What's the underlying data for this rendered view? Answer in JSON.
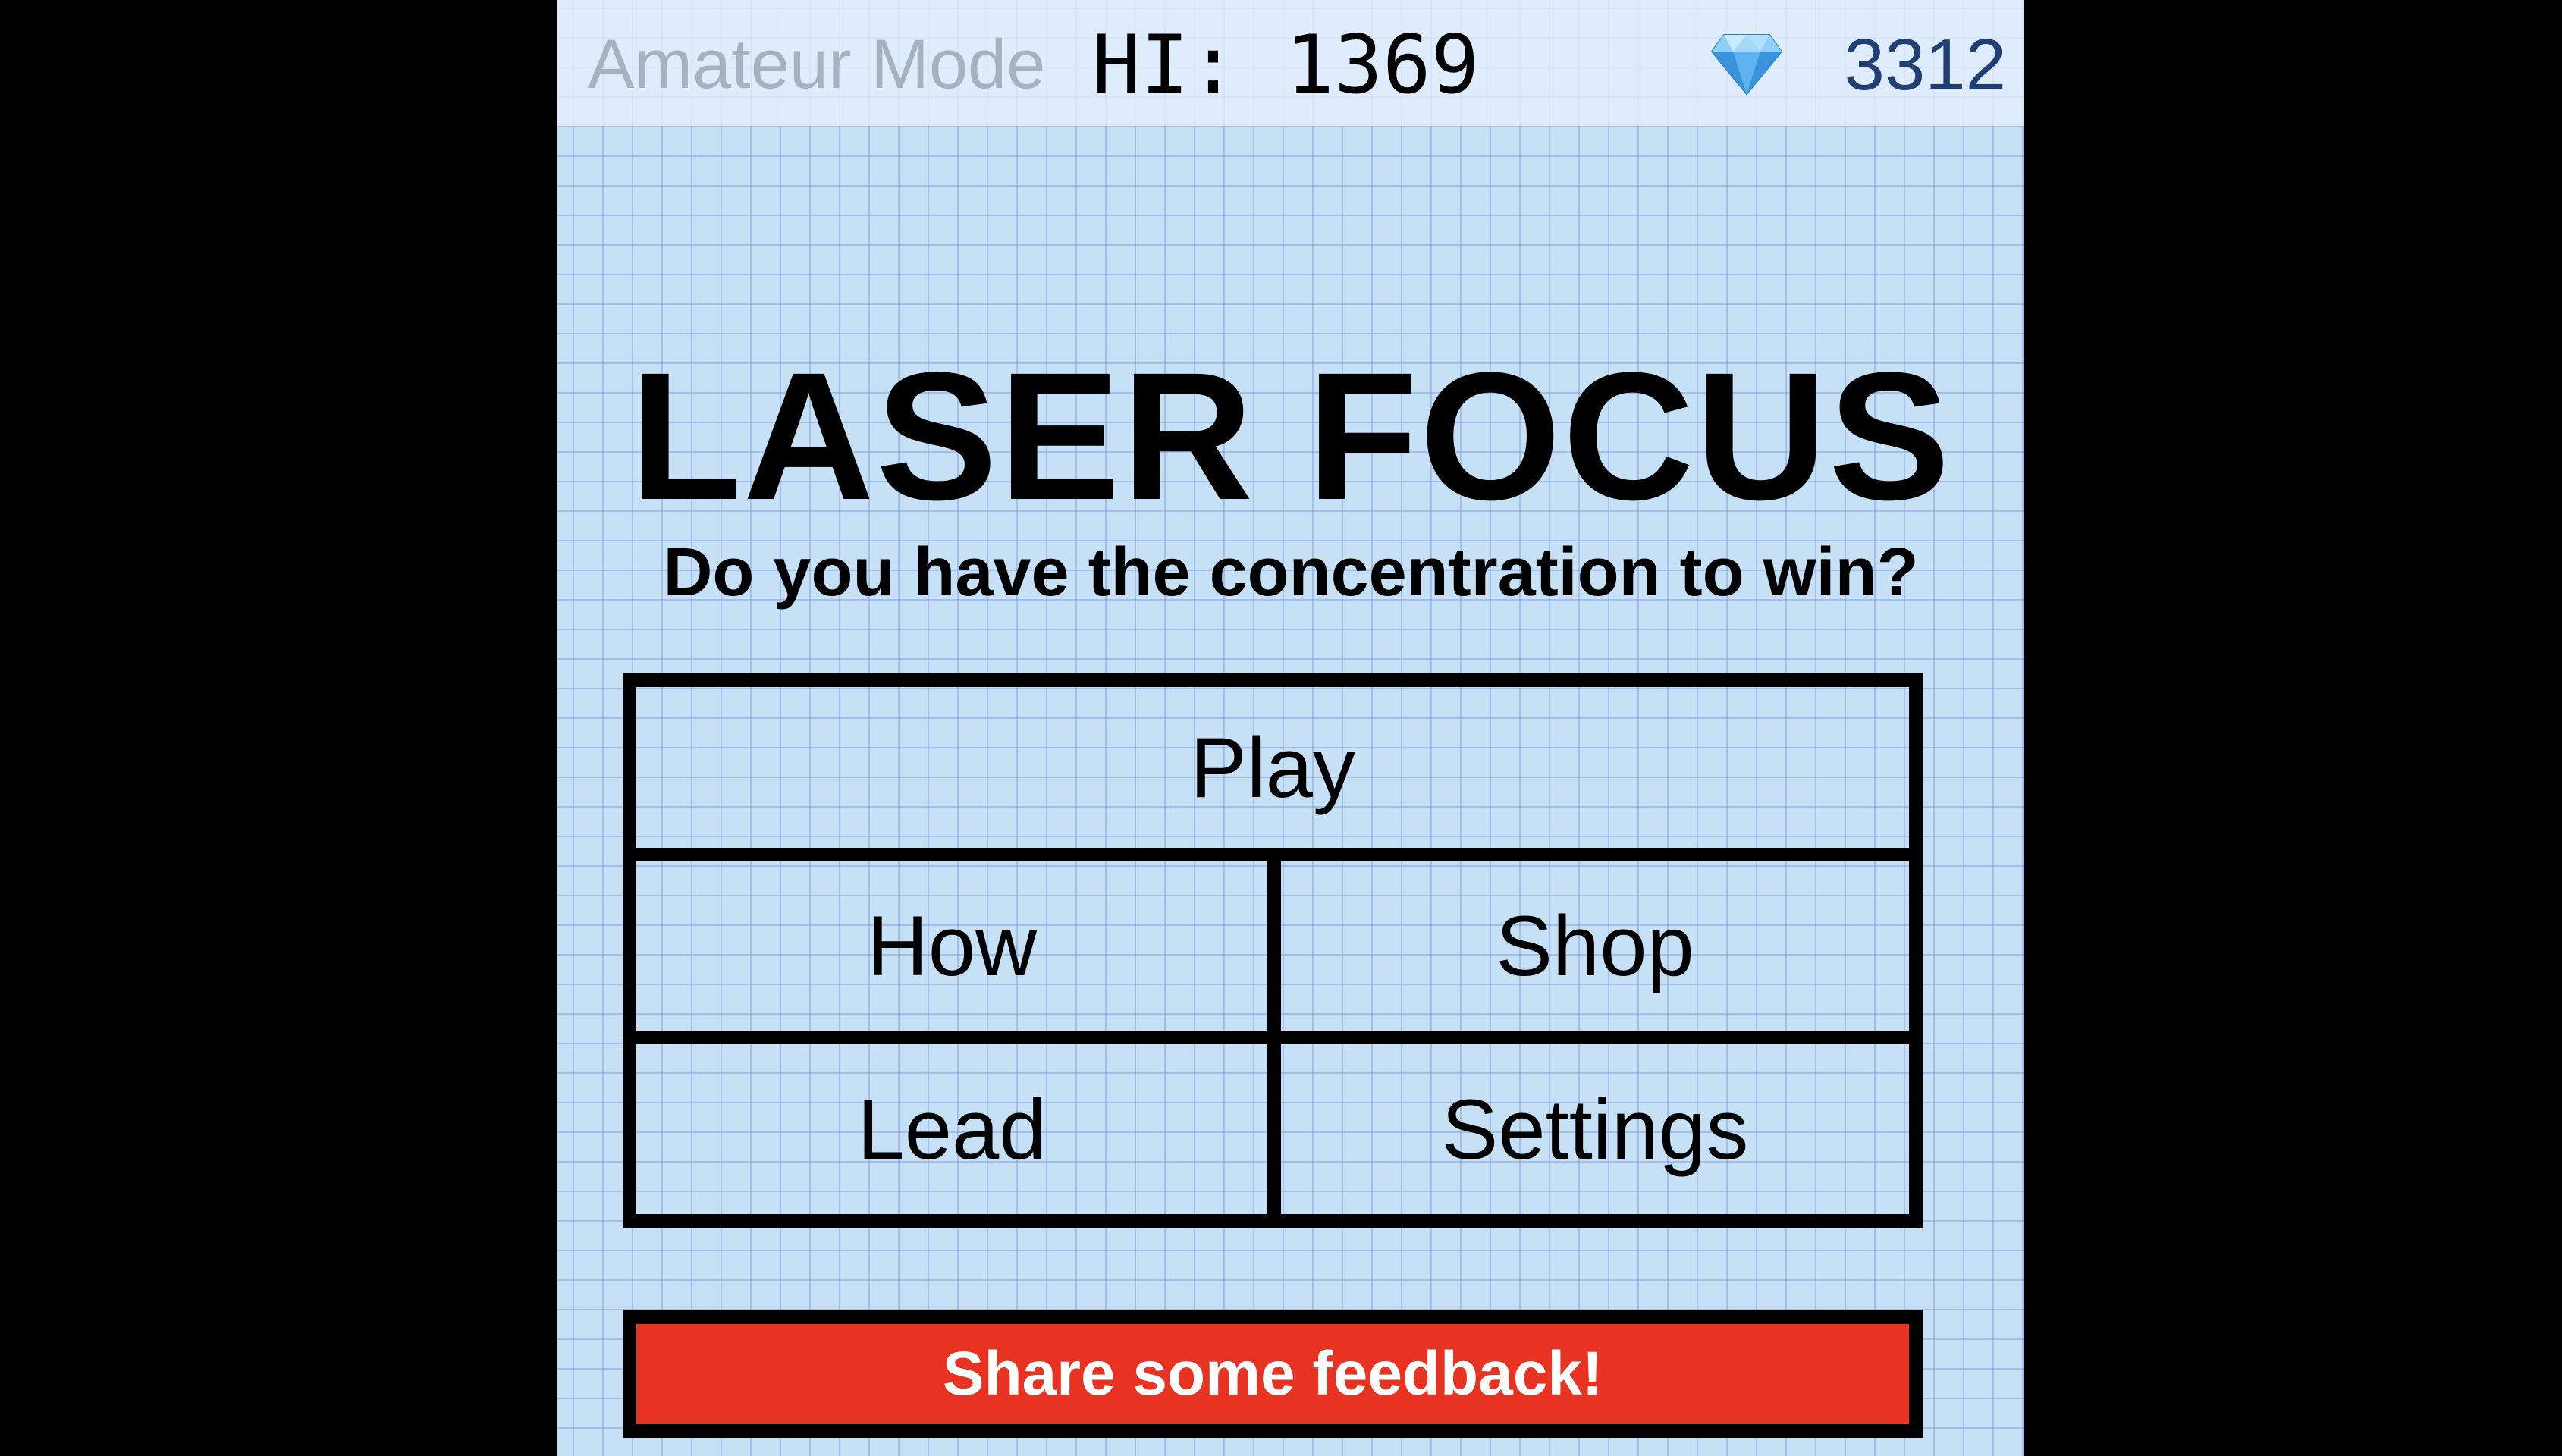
{
  "header": {
    "mode_label": "Amateur Mode",
    "hi_score": "HI: 1369",
    "gem_icon": "diamond-icon",
    "gem_count": "3312"
  },
  "title": {
    "main": "LASER FOCUS",
    "subtitle": "Do you have the concentration to win?"
  },
  "menu": {
    "play": "Play",
    "how": "How",
    "shop": "Shop",
    "lead": "Lead",
    "settings": "Settings"
  },
  "feedback": {
    "label": "Share some feedback!"
  },
  "colors": {
    "background": "#c6e0f5",
    "grid_line": "#5a78dc",
    "feedback_button": "#e83323",
    "gem_count_text": "#1f3f75",
    "mode_label_text": "#a8b2be"
  }
}
